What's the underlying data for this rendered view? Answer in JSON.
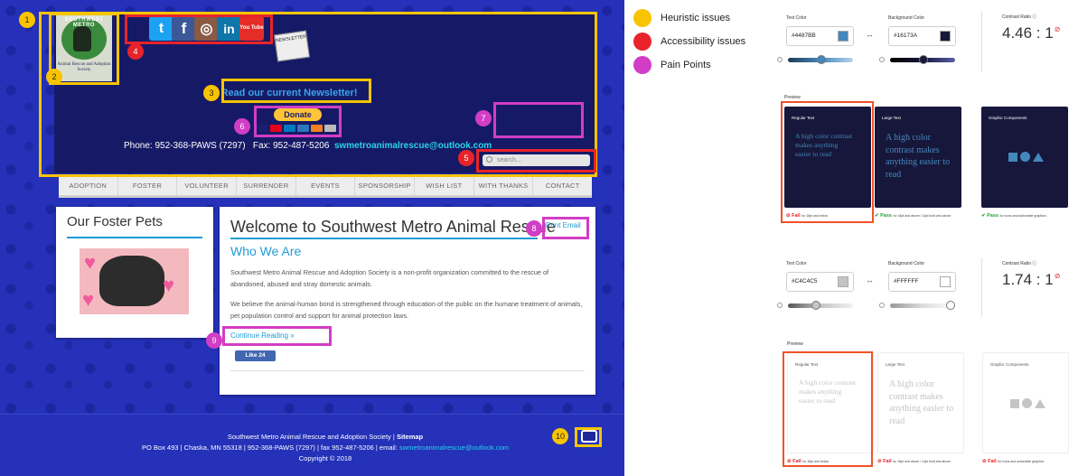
{
  "website": {
    "logo": {
      "arc_text": "SOUTHWEST METRO",
      "sub_text": "Animal Rescue and Adoption Society"
    },
    "social_icons": [
      {
        "name": "twitter-icon",
        "glyph": "t",
        "color": "#1da1f2"
      },
      {
        "name": "facebook-icon",
        "glyph": "f",
        "color": "#3b5998"
      },
      {
        "name": "instagram-icon",
        "glyph": "◎",
        "color": "#8a5a44"
      },
      {
        "name": "linkedin-icon",
        "glyph": "in",
        "color": "#0e76a8"
      },
      {
        "name": "youtube-icon",
        "glyph": "You Tube",
        "color": "#e52d27"
      }
    ],
    "newsletter_badge": "NEWSLETTER",
    "newsletter_link": "Read our current Newsletter!",
    "donate_label": "Donate",
    "contact": {
      "phone": "Phone: 952-368-PAWS (7297)",
      "fax": "Fax: 952-487-5206",
      "email": "swmetroanimalrescue@outlook.com"
    },
    "search_placeholder": "search...",
    "nav": [
      "ADOPTION",
      "FOSTER",
      "VOLUNTEER",
      "SURRENDER",
      "EVENTS",
      "SPONSORSHIP",
      "WISH LIST",
      "WITH THANKS",
      "CONTACT"
    ],
    "sidebar_title": "Our Foster Pets",
    "main_title": "Welcome to Southwest Metro Animal Rescue",
    "print_email": "Print Email",
    "sub_title": "Who We Are",
    "paragraphs": [
      "Southwest Metro Animal Rescue and Adoption Society is a non-profit organization committed to the rescue of abandoned, abused and stray domestic animals.",
      "We believe the animal-human bond is strengthened through education of the public on the humane treatment of animals, pet population control and support for animal protection laws."
    ],
    "continue_reading": "Continue Reading »",
    "fb_like": "Like 24",
    "footer": {
      "line1_prefix": "Southwest Metro Animal Rescue and Adoption Society | ",
      "line1_link": "Sitemap",
      "line2_prefix": "PO Box 493 | Chaska, MN 55318 | 952-368-PAWS (7297) | fax 952-487-5206 | email: ",
      "line2_email": "swmetroanimalrescue@outlook.com",
      "line3": "Copyright © 2018"
    }
  },
  "annotations": [
    {
      "num": "1",
      "type": "heuristic"
    },
    {
      "num": "2",
      "type": "heuristic"
    },
    {
      "num": "3",
      "type": "heuristic"
    },
    {
      "num": "4",
      "type": "accessibility"
    },
    {
      "num": "5",
      "type": "accessibility"
    },
    {
      "num": "6",
      "type": "pain"
    },
    {
      "num": "7",
      "type": "pain"
    },
    {
      "num": "8",
      "type": "pain"
    },
    {
      "num": "9",
      "type": "pain"
    },
    {
      "num": "10",
      "type": "heuristic"
    }
  ],
  "legend": [
    {
      "label": "Heuristic issues",
      "color": "#f8c400"
    },
    {
      "label": "Accessibility issues",
      "color": "#e8242a"
    },
    {
      "label": "Pain Points",
      "color": "#d23dc6"
    }
  ],
  "contrast_checks": [
    {
      "text_color_label": "Text Color",
      "text_color": "#4487BB",
      "bg_color_label": "Background Color",
      "bg_color": "#16173A",
      "ratio_label": "Contrast Ratio",
      "ratio": "4.46 : 1",
      "preview_label": "Preview",
      "previews": [
        {
          "title": "Regular Text",
          "sample": "A high color contrast makes anything easier to read",
          "status": "Fail",
          "note": "for 18pt and below"
        },
        {
          "title": "Large Text",
          "sample": "A high color contrast makes anything easier to read",
          "status": "Pass",
          "note": "for 18pt and above / 14pt bold and above"
        },
        {
          "title": "Graphic Components",
          "sample": "",
          "status": "Pass",
          "note": "for icons and actionable graphics"
        }
      ]
    },
    {
      "text_color_label": "Text Color",
      "text_color": "#C4C4C5",
      "bg_color_label": "Background Color",
      "bg_color": "#FFFFFF",
      "ratio_label": "Contrast Ratio",
      "ratio": "1.74 : 1",
      "preview_label": "Preview",
      "previews": [
        {
          "title": "Regular Text",
          "sample": "A high color contrast makes anything easier to read",
          "status": "Fail",
          "note": "for 18pt and below"
        },
        {
          "title": "Large Text",
          "sample": "A high color contrast makes anything easier to read",
          "status": "Fail",
          "note": "for 18pt and above / 14pt bold and above"
        },
        {
          "title": "Graphic Components",
          "sample": "",
          "status": "Fail",
          "note": "for icons and actionable graphics"
        }
      ]
    }
  ]
}
